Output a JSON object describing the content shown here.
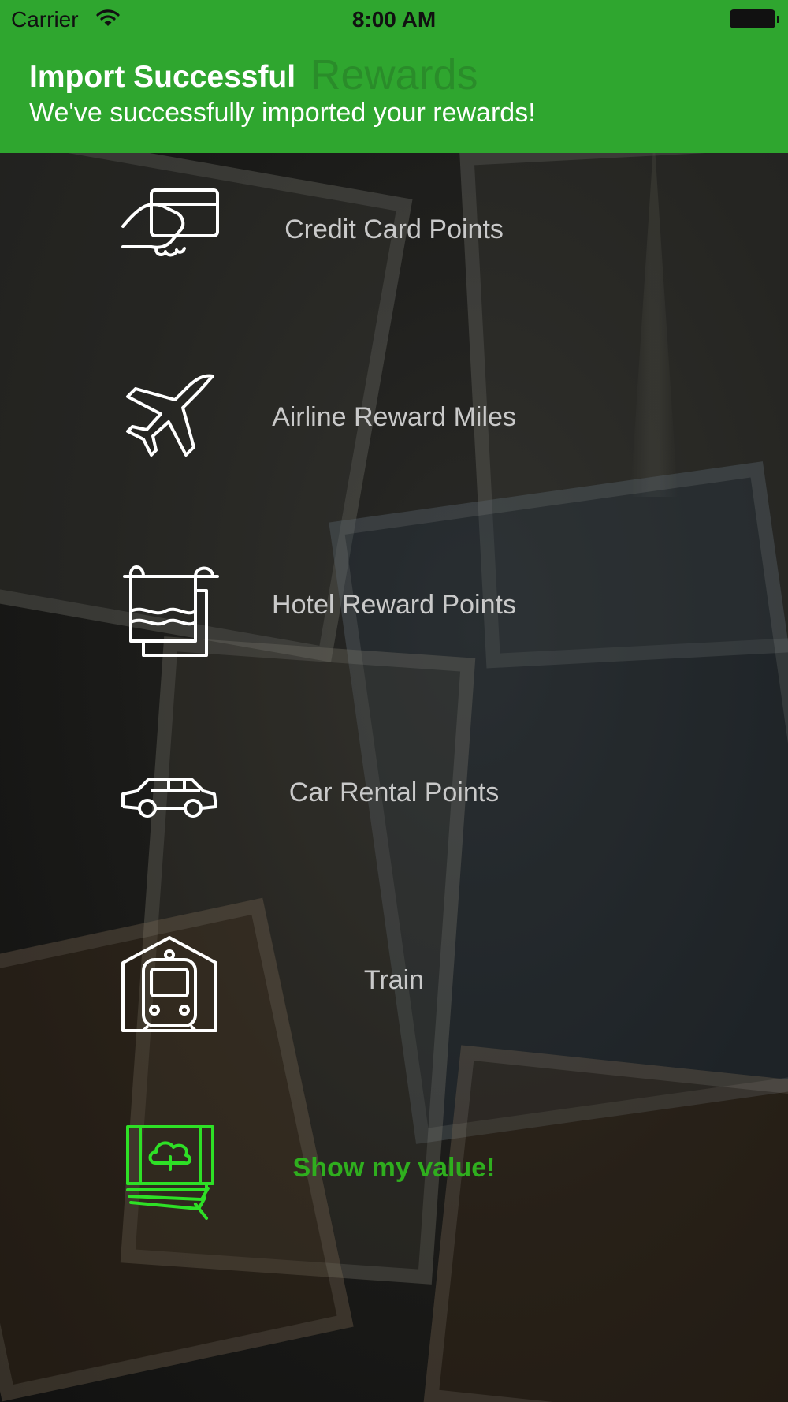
{
  "status_bar": {
    "carrier": "Carrier",
    "time": "8:00 AM"
  },
  "nav": {
    "title": "Rewards"
  },
  "notification": {
    "title": "Import Successful",
    "message": "We've successfully imported your rewards!",
    "color": "#2fa62f"
  },
  "menu": {
    "items": [
      {
        "label": "Credit Card Points",
        "icon": "credit-card-hand-icon"
      },
      {
        "label": "Airline Reward Miles",
        "icon": "airplane-icon"
      },
      {
        "label": "Hotel Reward Points",
        "icon": "hotel-towel-icon"
      },
      {
        "label": "Car Rental Points",
        "icon": "limousine-icon"
      },
      {
        "label": "Train",
        "icon": "train-icon"
      },
      {
        "label": "Show my value!",
        "icon": "money-cloud-icon",
        "accent_color": "#2fae1e"
      }
    ]
  }
}
